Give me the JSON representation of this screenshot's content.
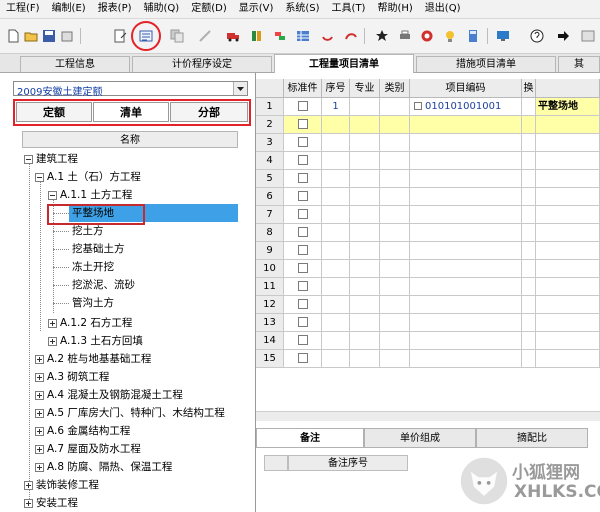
{
  "menubar": {
    "items": [
      "工程(F)",
      "编制(E)",
      "报表(P)",
      "辅助(Q)",
      "定额(D)",
      "显示(V)",
      "系统(S)",
      "工具(T)",
      "帮助(H)",
      "退出(Q)"
    ]
  },
  "top_tabs": [
    {
      "label": "工程信息",
      "active": false
    },
    {
      "label": "计价程序设定",
      "active": false
    },
    {
      "label": "工程量项目清单",
      "active": true
    },
    {
      "label": "措施项目清单",
      "active": false
    },
    {
      "label": "其",
      "active": false
    }
  ],
  "left": {
    "quota_select": "2009安徽土建定额",
    "subtabs": [
      "定额",
      "清单",
      "分部"
    ],
    "tree_header": "名称",
    "tree": [
      {
        "label": "建筑工程",
        "toggle": "minus"
      },
      {
        "label": "A.1 土（石）方工程",
        "toggle": "minus"
      },
      {
        "label": "A.1.1 土方工程",
        "toggle": "minus"
      },
      {
        "label": "平整场地",
        "toggle": "none"
      },
      {
        "label": "挖土方",
        "toggle": "none"
      },
      {
        "label": "挖基础土方",
        "toggle": "none"
      },
      {
        "label": "冻土开挖",
        "toggle": "none"
      },
      {
        "label": "挖淤泥、流砂",
        "toggle": "none"
      },
      {
        "label": "管沟土方",
        "toggle": "none"
      },
      {
        "label": "A.1.2 石方工程",
        "toggle": "plus"
      },
      {
        "label": "A.1.3 土石方回填",
        "toggle": "plus"
      },
      {
        "label": "A.2 桩与地基基础工程",
        "toggle": "plus"
      },
      {
        "label": "A.3 砌筑工程",
        "toggle": "plus"
      },
      {
        "label": "A.4 混凝土及钢筋混凝土工程",
        "toggle": "plus"
      },
      {
        "label": "A.5 厂库房大门、特种门、木结构工程",
        "toggle": "plus"
      },
      {
        "label": "A.6 金属结构工程",
        "toggle": "plus"
      },
      {
        "label": "A.7 屋面及防水工程",
        "toggle": "plus"
      },
      {
        "label": "A.8 防腐、隔热、保温工程",
        "toggle": "plus"
      },
      {
        "label": "装饰装修工程",
        "toggle": "plus"
      },
      {
        "label": "安装工程",
        "toggle": "plus"
      }
    ]
  },
  "grid": {
    "columns": [
      "标准件",
      "序号",
      "专业",
      "类别",
      "项目编码",
      "换"
    ],
    "row_numbers": [
      "1",
      "2",
      "3",
      "4",
      "5",
      "6",
      "7",
      "8",
      "9",
      "10",
      "11",
      "12",
      "13",
      "14",
      "15"
    ],
    "first_row": {
      "seq": "1",
      "code": "010101001001",
      "name": "平整场地"
    }
  },
  "bottom": {
    "tabs": [
      "备注",
      "单价组成",
      "摘配比"
    ],
    "note_header": "备注序号"
  },
  "watermark": {
    "line1": "小狐狸网",
    "line2": "XHLKS.COM"
  }
}
